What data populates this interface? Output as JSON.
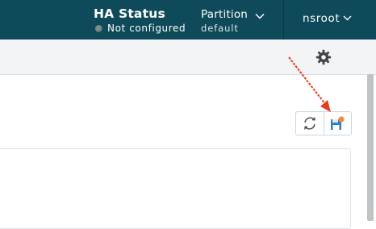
{
  "header": {
    "ha_title": "HA Status",
    "ha_status_text": "Not configured",
    "partition_title": "Partition",
    "partition_value": "default",
    "user": "nsroot"
  },
  "colors": {
    "header_bg": "#0e4a5a",
    "status_dot": "#7d8a8e",
    "annotation_arrow": "#e83a1e",
    "save_badge": "#f28a3c"
  },
  "icons": {
    "settings": "gear-icon",
    "refresh": "refresh-icon",
    "save": "save-icon",
    "dropdown": "chevron-down-icon"
  }
}
